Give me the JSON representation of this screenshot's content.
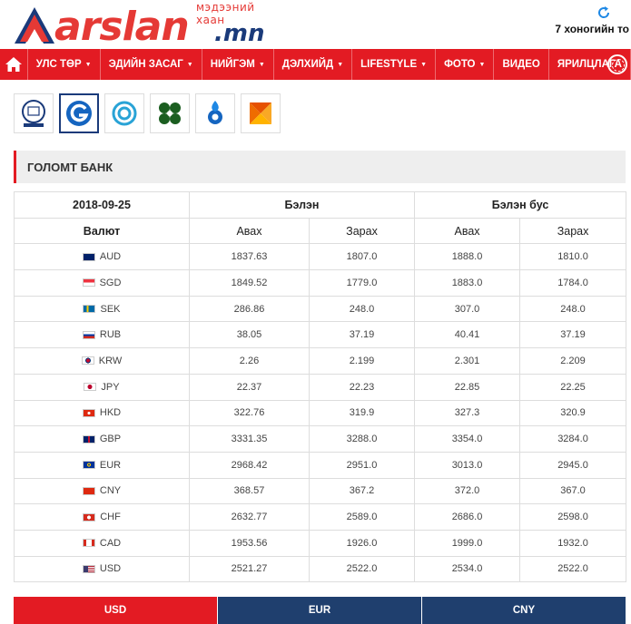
{
  "header": {
    "logo_tagline": "мэдээний хаан",
    "logo_main": "arslan",
    "logo_domain": ".mn",
    "week_link": "7 хоногийн то"
  },
  "nav": {
    "items": [
      "УЛС ТӨР",
      "ЭДИЙН ЗАСАГ",
      "НИЙГЭМ",
      "ДЭЛХИЙД",
      "LIFESTYLE",
      "ФОТО",
      "ВИДЕО",
      "ЯРИЛЦЛАГА"
    ],
    "has_caret": [
      true,
      true,
      true,
      true,
      true,
      true,
      false,
      false
    ]
  },
  "banks": [
    "mongolbank",
    "golomt",
    "khan",
    "tdb",
    "xac",
    "state"
  ],
  "section_title": "ГОЛОМТ БАНК",
  "table": {
    "date": "2018-09-25",
    "cash_header": "Бэлэн",
    "noncash_header": "Бэлэн бус",
    "currency_header": "Валют",
    "buy": "Авах",
    "sell": "Зарах",
    "rows": [
      {
        "code": "AUD",
        "flag": "au",
        "cash_buy": "1837.63",
        "cash_sell": "1807.0",
        "nc_buy": "1888.0",
        "nc_sell": "1810.0"
      },
      {
        "code": "SGD",
        "flag": "sg",
        "cash_buy": "1849.52",
        "cash_sell": "1779.0",
        "nc_buy": "1883.0",
        "nc_sell": "1784.0"
      },
      {
        "code": "SEK",
        "flag": "se",
        "cash_buy": "286.86",
        "cash_sell": "248.0",
        "nc_buy": "307.0",
        "nc_sell": "248.0"
      },
      {
        "code": "RUB",
        "flag": "ru",
        "cash_buy": "38.05",
        "cash_sell": "37.19",
        "nc_buy": "40.41",
        "nc_sell": "37.19"
      },
      {
        "code": "KRW",
        "flag": "kr",
        "cash_buy": "2.26",
        "cash_sell": "2.199",
        "nc_buy": "2.301",
        "nc_sell": "2.209"
      },
      {
        "code": "JPY",
        "flag": "jp",
        "cash_buy": "22.37",
        "cash_sell": "22.23",
        "nc_buy": "22.85",
        "nc_sell": "22.25"
      },
      {
        "code": "HKD",
        "flag": "hk",
        "cash_buy": "322.76",
        "cash_sell": "319.9",
        "nc_buy": "327.3",
        "nc_sell": "320.9"
      },
      {
        "code": "GBP",
        "flag": "gb",
        "cash_buy": "3331.35",
        "cash_sell": "3288.0",
        "nc_buy": "3354.0",
        "nc_sell": "3284.0"
      },
      {
        "code": "EUR",
        "flag": "eu",
        "cash_buy": "2968.42",
        "cash_sell": "2951.0",
        "nc_buy": "3013.0",
        "nc_sell": "2945.0"
      },
      {
        "code": "CNY",
        "flag": "cn",
        "cash_buy": "368.57",
        "cash_sell": "367.2",
        "nc_buy": "372.0",
        "nc_sell": "367.0"
      },
      {
        "code": "CHF",
        "flag": "ch",
        "cash_buy": "2632.77",
        "cash_sell": "2589.0",
        "nc_buy": "2686.0",
        "nc_sell": "2598.0"
      },
      {
        "code": "CAD",
        "flag": "ca",
        "cash_buy": "1953.56",
        "cash_sell": "1926.0",
        "nc_buy": "1999.0",
        "nc_sell": "1932.0"
      },
      {
        "code": "USD",
        "flag": "us",
        "cash_buy": "2521.27",
        "cash_sell": "2522.0",
        "nc_buy": "2534.0",
        "nc_sell": "2522.0"
      }
    ]
  },
  "tabs": [
    "USD",
    "EUR",
    "CNY"
  ],
  "colors": {
    "brand_red": "#e31b23",
    "brand_blue": "#1f3f6e"
  }
}
